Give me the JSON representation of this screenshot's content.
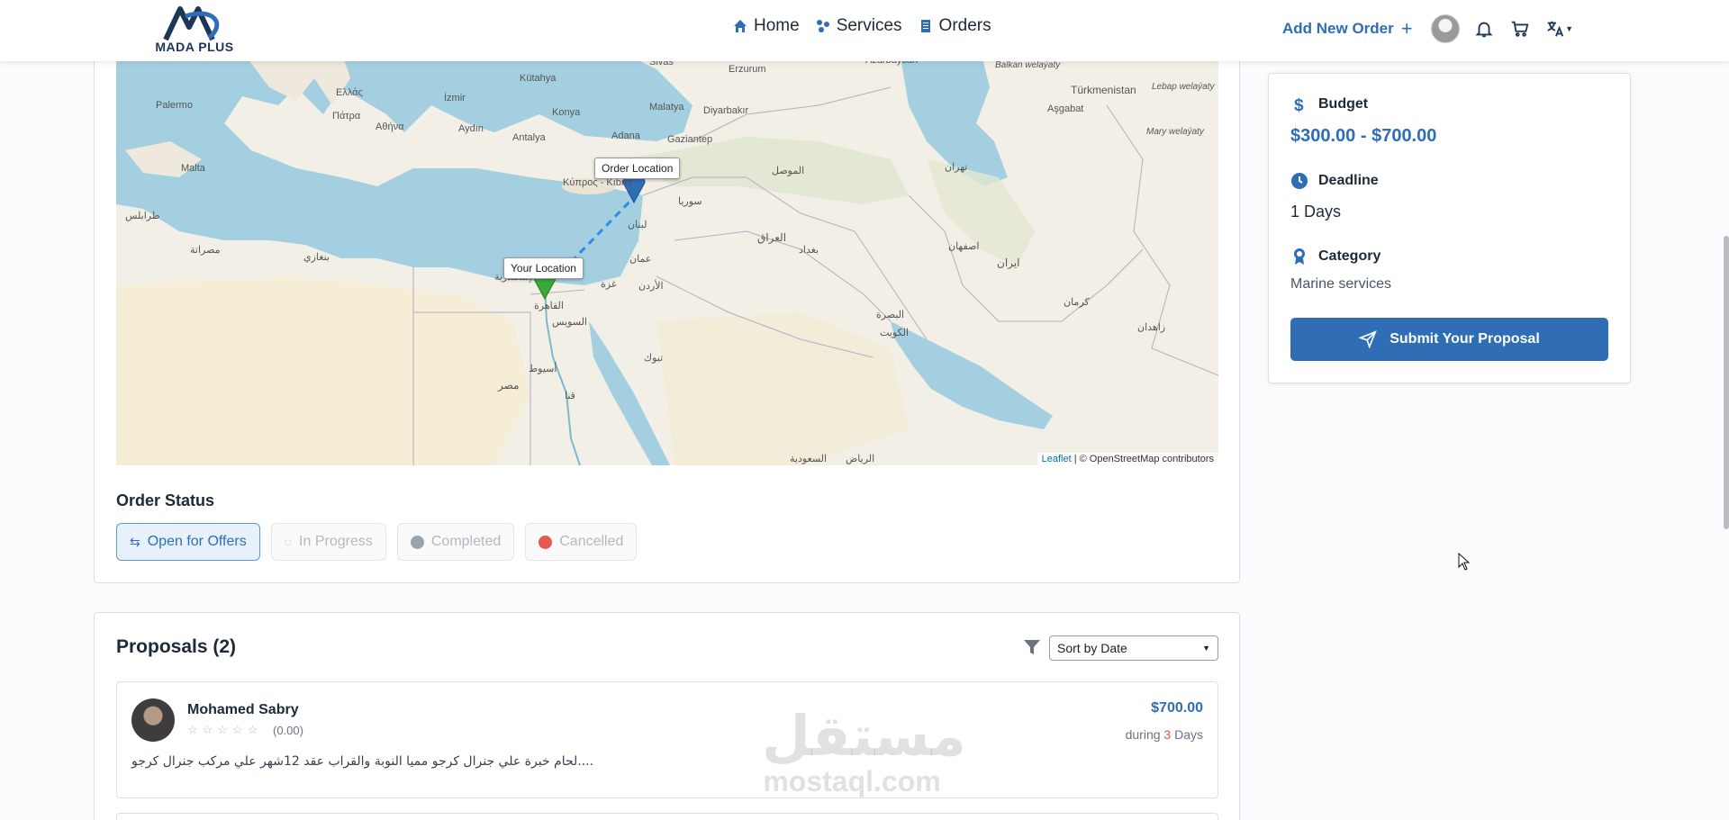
{
  "nav": {
    "logo_text": "MADA PLUS",
    "links": [
      {
        "label": "Home",
        "icon": "home-icon"
      },
      {
        "label": "Services",
        "icon": "services-icon"
      },
      {
        "label": "Orders",
        "icon": "orders-icon"
      }
    ],
    "add_order": "Add New Order"
  },
  "map": {
    "tooltip_order": "Order Location",
    "tooltip_your": "Your Location",
    "attribution_leaflet": "Leaflet",
    "attribution_rest": "| © OpenStreetMap contributors",
    "labels": {
      "palermo": "Palermo",
      "malta": "Malta",
      "izmir": "İzmir",
      "aydin": "Aydın",
      "antalya": "Antalya",
      "konya": "Konya",
      "adana": "Adana",
      "gaziantep": "Gaziantep",
      "malatya": "Malatya",
      "sivas": "Sivas",
      "erzurum": "Erzurum",
      "kutahya": "Kütahya",
      "diyarbakir": "Diyarbakır",
      "azarbaycan": "Azarbaycan",
      "kibris": "Κύπρος - Kıbrıs",
      "turkmenistan": "Türkmenistan",
      "asgabat": "Aşgabat",
      "balkan": "Balkan welaýaty",
      "lebap": "Lebap welaýaty",
      "mary": "Mary welaýaty",
      "ellada": "Ελλάς",
      "athina": "Αθήνα",
      "patra": "Πάτρα",
      "iraq": "العراق",
      "iran": "ایران",
      "misr": "مصر",
      "cairo": "القاهرة",
      "alex": "الإسكندرية",
      "syria": "سوريا",
      "jordan": "الأردن",
      "tabuk": "تبوك",
      "riyadh": "الرياض",
      "saudi": "السعودية",
      "kuwait": "الكويت",
      "basra": "البصرة",
      "tehran": "تهران",
      "isfahan": "اصفهان",
      "kerman": "کرمان",
      "zahedan": "زاهدان",
      "mosul": "الموصل",
      "baghdad": "بغداد",
      "tripoli": "طرابلس",
      "benghazi": "بنغازي",
      "misrata": "مصراتة",
      "suez": "السويس",
      "asyut": "أسيوط",
      "qena": "قنا",
      "ghaza": "غزة",
      "amman": "عمان",
      "lubnan": "لبنان"
    }
  },
  "order_status": {
    "title": "Order Status",
    "buttons": [
      "Open for Offers",
      "In Progress",
      "Completed",
      "Cancelled"
    ]
  },
  "sidebar": {
    "budget_label": "Budget",
    "budget_value": "$300.00 - $700.00",
    "deadline_label": "Deadline",
    "deadline_value": "1 Days",
    "category_label": "Category",
    "category_value": "Marine services",
    "submit": "Submit Your Proposal"
  },
  "proposals": {
    "title": "Proposals (2)",
    "sort_value": "Sort by Date",
    "items": [
      {
        "name": "Mohamed Sabry",
        "stars": "☆☆☆☆☆",
        "rating": "(0.00)",
        "price": "$700.00",
        "during_prefix": "during",
        "during_num": "3",
        "during_suffix": "Days",
        "desc": "لحام خبرة علي جنرال كرجو مميا النوبة والقراب عقد 12شهر علي مركب جنرال كرجو...."
      }
    ],
    "watermark_ar": "مستقل",
    "watermark_en": "mostaql.com"
  },
  "colors": {
    "accent": "#2f6db5",
    "sea": "#a4cfe0",
    "land": "#f2efe6",
    "marker_order": "#2f6db5",
    "marker_your": "#3aa83a"
  }
}
